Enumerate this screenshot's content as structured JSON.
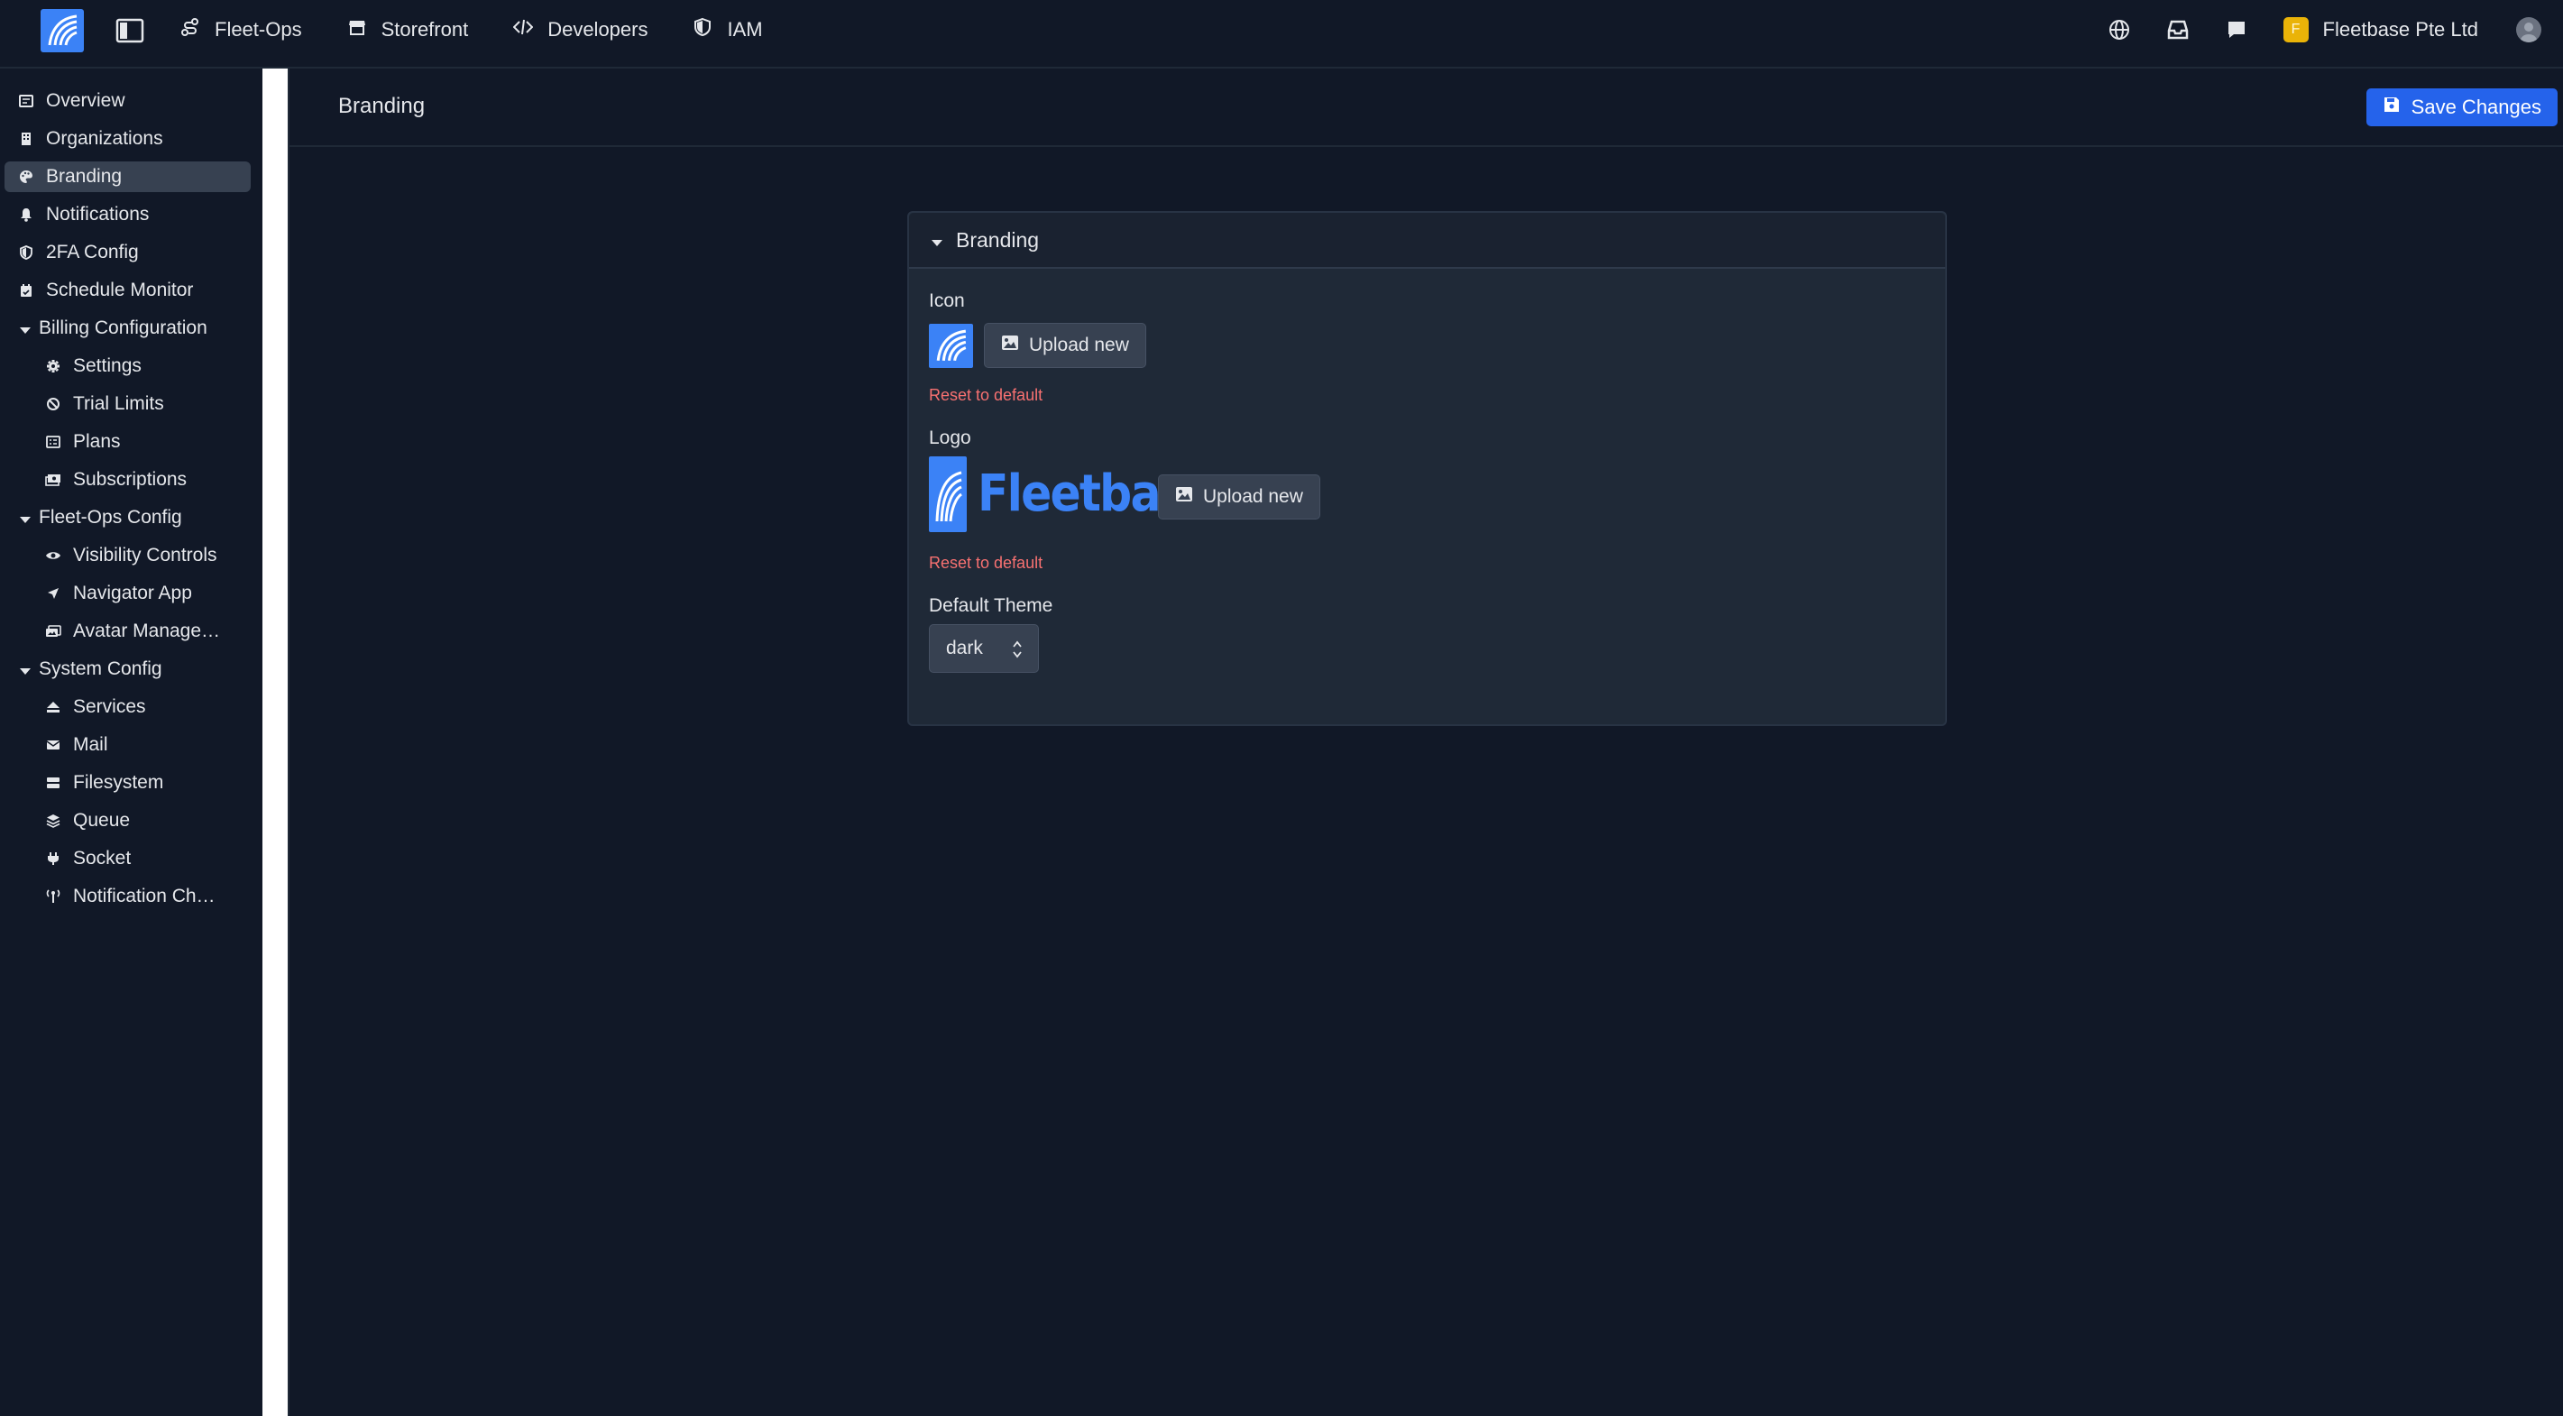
{
  "topbar": {
    "nav": [
      {
        "label": "Fleet-Ops",
        "icon": "route-icon"
      },
      {
        "label": "Storefront",
        "icon": "store-icon"
      },
      {
        "label": "Developers",
        "icon": "code-icon"
      },
      {
        "label": "IAM",
        "icon": "shield-icon"
      }
    ],
    "org_initial": "F",
    "org_name": "Fleetbase Pte Ltd",
    "org_badge_color": "#eab308",
    "right_icons": [
      "globe-icon",
      "inbox-icon",
      "chat-icon"
    ]
  },
  "sidebar": {
    "items": [
      {
        "label": "Overview",
        "icon": "overview-icon"
      },
      {
        "label": "Organizations",
        "icon": "building-icon"
      },
      {
        "label": "Branding",
        "icon": "palette-icon",
        "active": true
      },
      {
        "label": "Notifications",
        "icon": "bell-icon"
      },
      {
        "label": "2FA Config",
        "icon": "shield-icon"
      },
      {
        "label": "Schedule Monitor",
        "icon": "calendar-icon"
      }
    ],
    "groups": [
      {
        "label": "Billing Configuration",
        "items": [
          {
            "label": "Settings",
            "icon": "gear-icon"
          },
          {
            "label": "Trial Limits",
            "icon": "ban-icon"
          },
          {
            "label": "Plans",
            "icon": "list-icon"
          },
          {
            "label": "Subscriptions",
            "icon": "money-icon"
          }
        ]
      },
      {
        "label": "Fleet-Ops Config",
        "items": [
          {
            "label": "Visibility Controls",
            "icon": "eye-icon"
          },
          {
            "label": "Navigator App",
            "icon": "location-arrow-icon"
          },
          {
            "label": "Avatar Manage…",
            "icon": "images-icon"
          }
        ]
      },
      {
        "label": "System Config",
        "items": [
          {
            "label": "Services",
            "icon": "eject-icon"
          },
          {
            "label": "Mail",
            "icon": "envelope-icon"
          },
          {
            "label": "Filesystem",
            "icon": "database-icon"
          },
          {
            "label": "Queue",
            "icon": "layers-icon"
          },
          {
            "label": "Socket",
            "icon": "plug-icon"
          },
          {
            "label": "Notification Ch…",
            "icon": "broadcast-icon"
          }
        ]
      }
    ]
  },
  "page": {
    "title": "Branding",
    "save_label": "Save Changes",
    "accent_color": "#2563eb"
  },
  "panel": {
    "title": "Branding",
    "icon_field": {
      "label": "Icon",
      "upload_label": "Upload new",
      "reset_label": "Reset to default"
    },
    "logo_field": {
      "label": "Logo",
      "upload_label": "Upload new",
      "reset_label": "Reset to default",
      "logo_text": "Fleetbase"
    },
    "theme_field": {
      "label": "Default Theme",
      "value": "dark"
    }
  }
}
